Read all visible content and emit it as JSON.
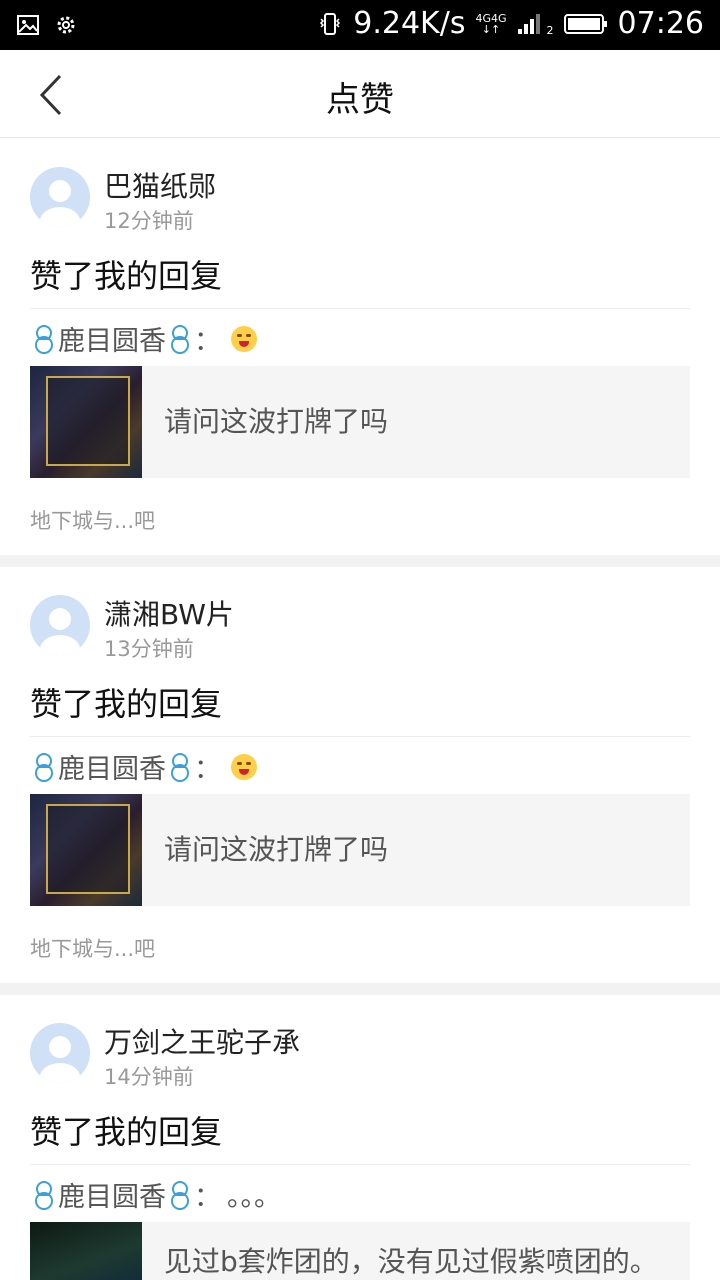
{
  "status_bar": {
    "net_speed": "9.24K/s",
    "net_left": "4G",
    "net_right": "4G",
    "sim_index": "2",
    "time": "07:26",
    "icons": [
      "image-icon",
      "gear-icon",
      "vibrate-icon",
      "signal-icon",
      "battery-icon"
    ]
  },
  "nav": {
    "title": "点赞",
    "back_icon": "chevron-left-icon"
  },
  "items": [
    {
      "username": "巴猫纸郧",
      "time": "12分钟前",
      "action": "赞了我的回复",
      "quote_author": "鹿目圆香",
      "quote_sep": "：",
      "quote_suffix": "",
      "post_text": "请问这波打牌了吗",
      "forum": "地下城与...吧"
    },
    {
      "username": "潇湘BW片",
      "time": "13分钟前",
      "action": "赞了我的回复",
      "quote_author": "鹿目圆香",
      "quote_sep": "：",
      "quote_suffix": "",
      "post_text": "请问这波打牌了吗",
      "forum": "地下城与...吧"
    },
    {
      "username": "万剑之王驼子承",
      "time": "14分钟前",
      "action": "赞了我的回复",
      "quote_author": "鹿目圆香",
      "quote_sep": "：",
      "quote_suffix": "。。。",
      "post_text": "见过b套炸团的，没有见过假紫喷团的。"
    }
  ]
}
